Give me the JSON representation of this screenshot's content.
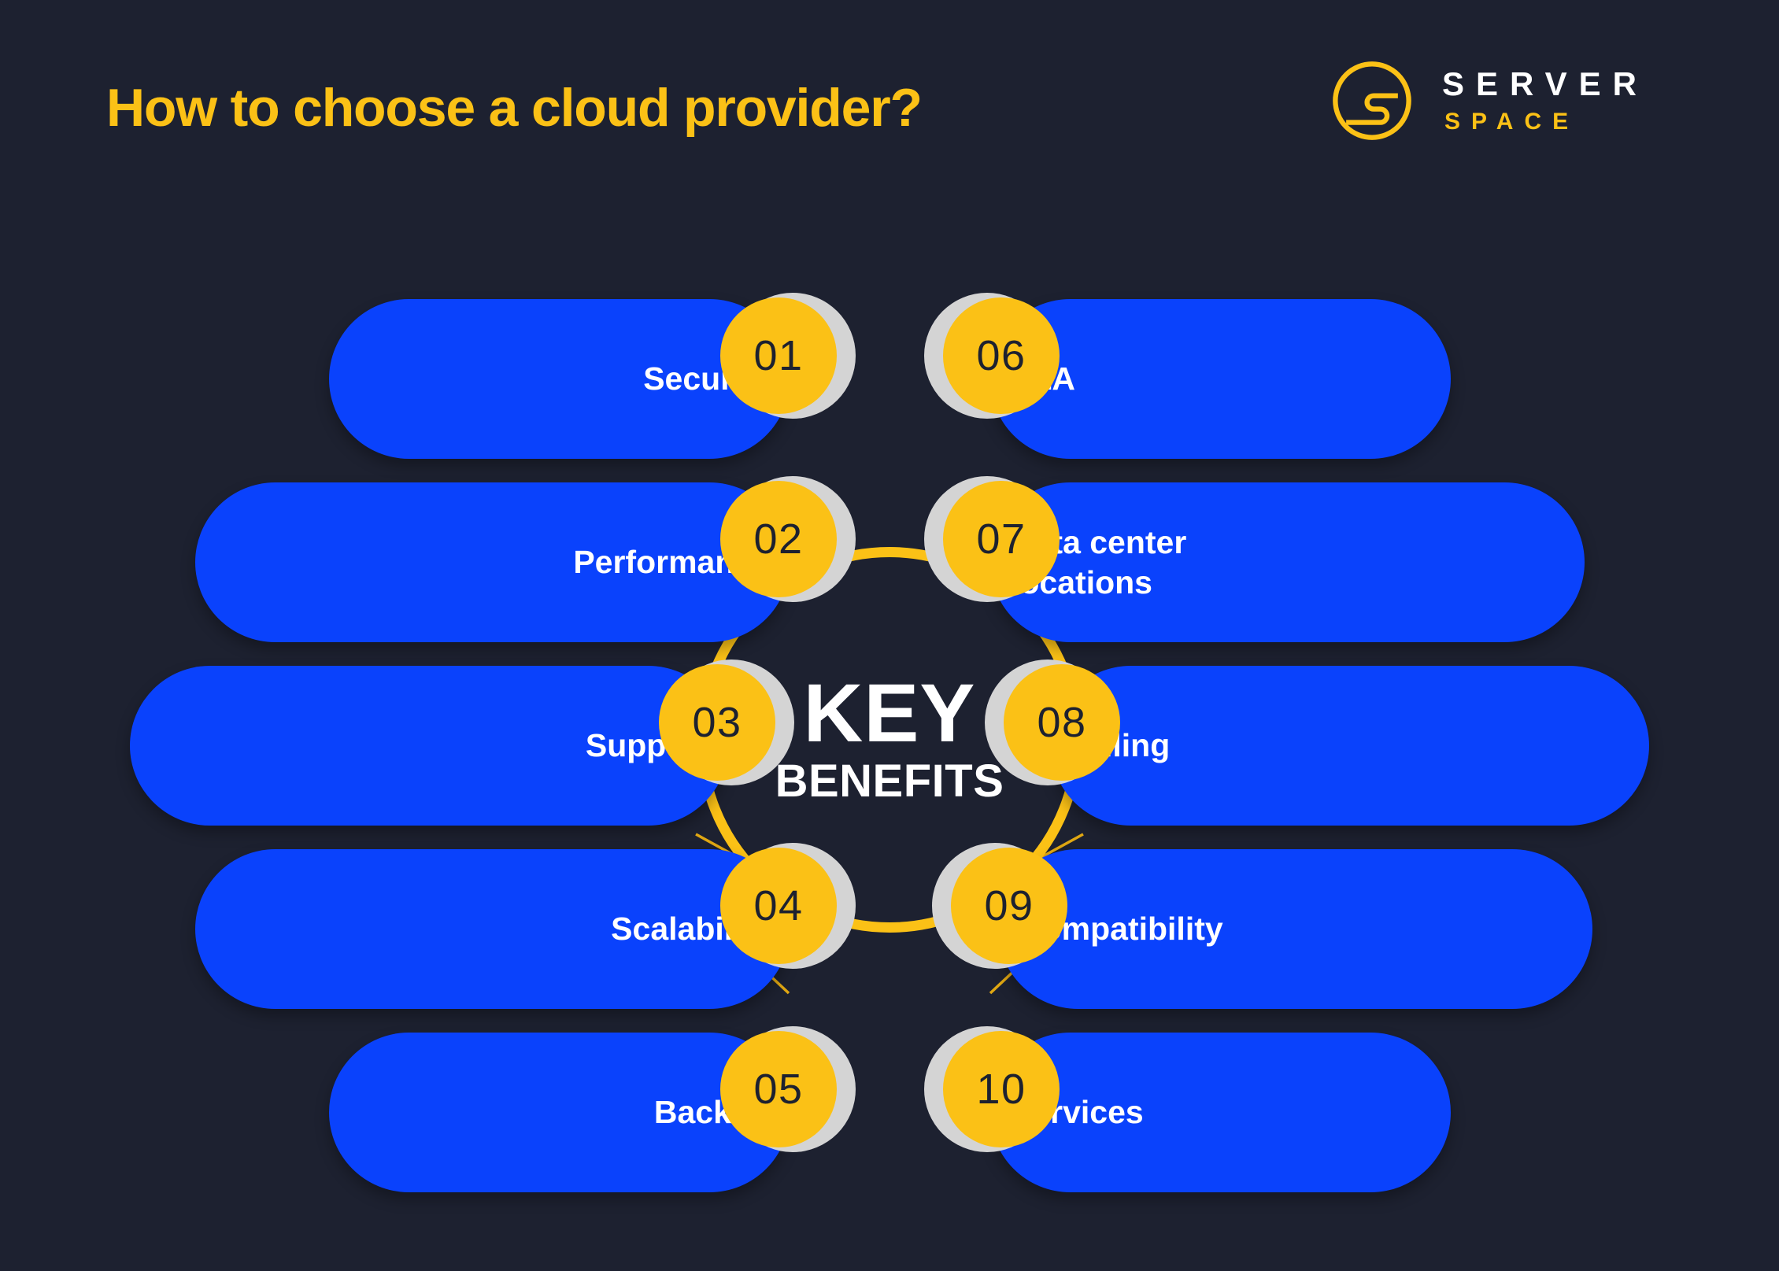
{
  "page": {
    "title": "How to choose a cloud provider?",
    "background_color": "#1d2130",
    "accent_yellow": "#fbc116",
    "accent_blue": "#0a42fc",
    "ring_gray": "#d4d4d4",
    "text_white": "#ffffff"
  },
  "logo": {
    "mark": "servertree-s-circle-logo",
    "word_primary": "SERVER",
    "word_secondary": "SPACE"
  },
  "hub": {
    "line1": "KEY",
    "line2": "BENEFITS"
  },
  "items_left": [
    {
      "number": "01",
      "label": "Security"
    },
    {
      "number": "02",
      "label": "Performance"
    },
    {
      "number": "03",
      "label": "Support"
    },
    {
      "number": "04",
      "label": "Scalability"
    },
    {
      "number": "05",
      "label": "Backup"
    }
  ],
  "items_right": [
    {
      "number": "06",
      "label": "SLA"
    },
    {
      "number": "07",
      "label": "Data center\nlocations"
    },
    {
      "number": "08",
      "label": "Billing"
    },
    {
      "number": "09",
      "label": "Compatibility"
    },
    {
      "number": "10",
      "label": "Services"
    }
  ]
}
